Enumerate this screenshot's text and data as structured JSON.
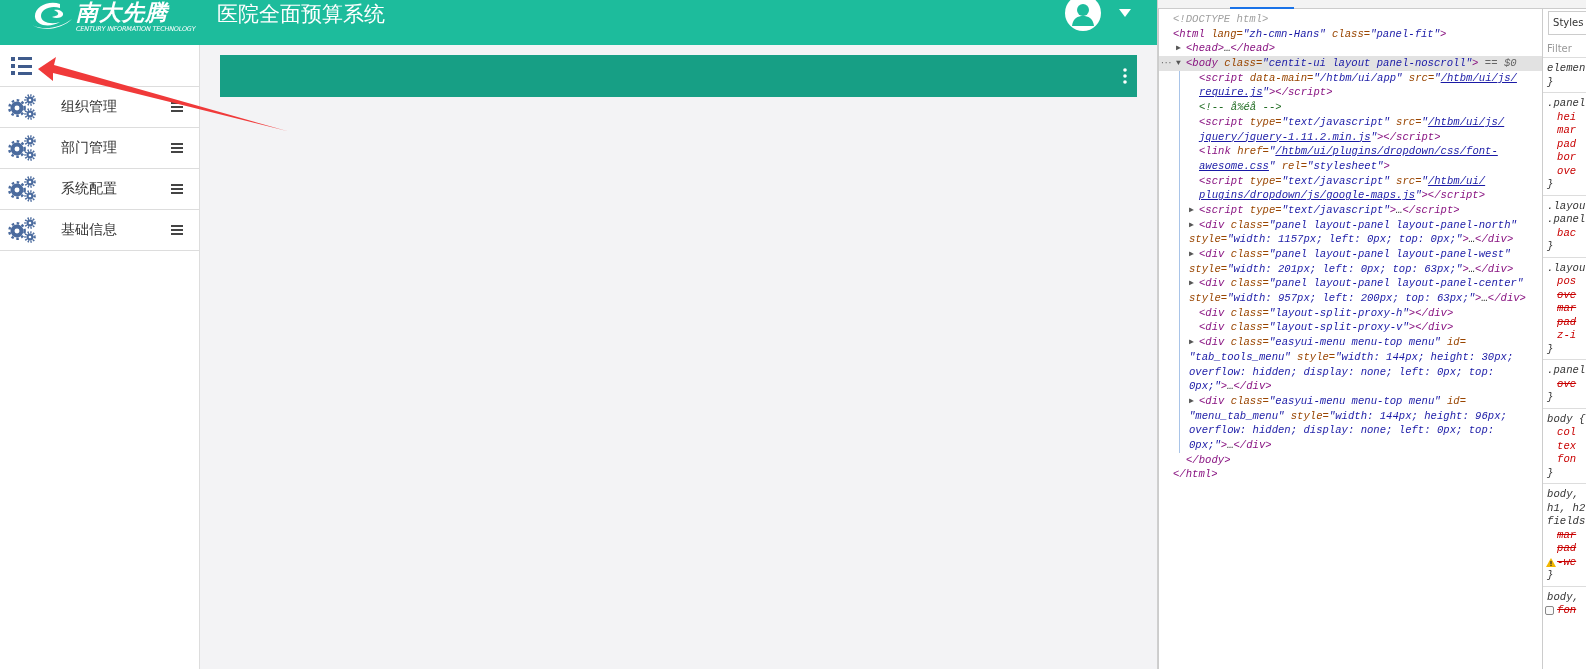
{
  "header": {
    "logo_text": "南大先腾",
    "logo_subtitle": "CENTURY INFORMATION TECHNOLOGY",
    "title": "医院全面预算系统"
  },
  "sidebar": {
    "items": [
      {
        "label": "组织管理"
      },
      {
        "label": "部门管理"
      },
      {
        "label": "系统配置"
      },
      {
        "label": "基础信息"
      }
    ]
  },
  "devtools": {
    "dom": [
      {
        "selected": false,
        "lines": [
          [
            {
              "kind": "doctype",
              "text": "<!DOCTYPE html>"
            }
          ]
        ]
      },
      {
        "selected": false,
        "lines": [
          [
            {
              "kind": "tag",
              "text": "<html"
            },
            {
              "kind": "attr",
              "text": " lang="
            },
            {
              "kind": "value",
              "text": "\"zh-cmn-Hans\""
            },
            {
              "kind": "attr",
              "text": " class="
            },
            {
              "kind": "value",
              "text": "\"panel-fit\""
            },
            {
              "kind": "tag",
              "text": ">"
            }
          ]
        ],
        "close": [
          {
            "kind": "tag",
            "text": "</html>"
          }
        ],
        "children": [
          {
            "selected": false,
            "toggle": "▶",
            "lines": [
              [
                {
                  "kind": "tag",
                  "text": "<head>"
                },
                {
                  "kind": "text",
                  "text": "…"
                },
                {
                  "kind": "tag",
                  "text": "</head>"
                }
              ]
            ]
          },
          {
            "selected": true,
            "prefix": "···",
            "toggle": "▼",
            "lines": [
              [
                {
                  "kind": "tag",
                  "text": "<body"
                },
                {
                  "kind": "attr",
                  "text": " class="
                },
                {
                  "kind": "value",
                  "text": "\"centit-ui layout panel-noscroll\""
                },
                {
                  "kind": "tag",
                  "text": ">"
                },
                {
                  "kind": "marker",
                  "text": " == $0"
                }
              ]
            ],
            "close": [
              {
                "kind": "tag",
                "text": "</body>"
              }
            ],
            "children": [
              {
                "selected": false,
                "lines": [
                  [
                    {
                      "kind": "tag",
                      "text": "<script"
                    },
                    {
                      "kind": "attr",
                      "text": " data-main="
                    },
                    {
                      "kind": "value",
                      "text": "\"/htbm/ui/app\""
                    },
                    {
                      "kind": "attr",
                      "text": " src="
                    },
                    {
                      "kind": "value",
                      "text": "\""
                    },
                    {
                      "kind": "link",
                      "text": "/htbm/ui/js/"
                    }
                  ],
                  [
                    {
                      "kind": "link",
                      "text": "require.js"
                    },
                    {
                      "kind": "value",
                      "text": "\""
                    },
                    {
                      "kind": "tag",
                      "text": "></script>"
                    }
                  ]
                ]
              },
              {
                "selected": false,
                "lines": [
                  [
                    {
                      "kind": "comment",
                      "text": "<!-- å%éå -->"
                    }
                  ]
                ]
              },
              {
                "selected": false,
                "lines": [
                  [
                    {
                      "kind": "tag",
                      "text": "<script"
                    },
                    {
                      "kind": "attr",
                      "text": " type="
                    },
                    {
                      "kind": "value",
                      "text": "\"text/javascript\""
                    },
                    {
                      "kind": "attr",
                      "text": " src="
                    },
                    {
                      "kind": "value",
                      "text": "\""
                    },
                    {
                      "kind": "link",
                      "text": "/htbm/ui/js/"
                    }
                  ],
                  [
                    {
                      "kind": "link",
                      "text": "jquery/jquery-1.11.2.min.js"
                    },
                    {
                      "kind": "value",
                      "text": "\""
                    },
                    {
                      "kind": "tag",
                      "text": "></script>"
                    }
                  ]
                ]
              },
              {
                "selected": false,
                "lines": [
                  [
                    {
                      "kind": "tag",
                      "text": "<link"
                    },
                    {
                      "kind": "attr",
                      "text": " href="
                    },
                    {
                      "kind": "value",
                      "text": "\""
                    },
                    {
                      "kind": "link",
                      "text": "/htbm/ui/plugins/dropdown/css/font-"
                    }
                  ],
                  [
                    {
                      "kind": "link",
                      "text": "awesome.css"
                    },
                    {
                      "kind": "value",
                      "text": "\""
                    },
                    {
                      "kind": "attr",
                      "text": " rel="
                    },
                    {
                      "kind": "value",
                      "text": "\"stylesheet\""
                    },
                    {
                      "kind": "tag",
                      "text": ">"
                    }
                  ]
                ]
              },
              {
                "selected": false,
                "lines": [
                  [
                    {
                      "kind": "tag",
                      "text": "<script"
                    },
                    {
                      "kind": "attr",
                      "text": " type="
                    },
                    {
                      "kind": "value",
                      "text": "\"text/javascript\""
                    },
                    {
                      "kind": "attr",
                      "text": " src="
                    },
                    {
                      "kind": "value",
                      "text": "\""
                    },
                    {
                      "kind": "link",
                      "text": "/htbm/ui/"
                    }
                  ],
                  [
                    {
                      "kind": "link",
                      "text": "plugins/dropdown/js/google-maps.js"
                    },
                    {
                      "kind": "value",
                      "text": "\""
                    },
                    {
                      "kind": "tag",
                      "text": "></script>"
                    }
                  ]
                ]
              },
              {
                "selected": false,
                "toggle": "▶",
                "lines": [
                  [
                    {
                      "kind": "tag",
                      "text": "<script"
                    },
                    {
                      "kind": "attr",
                      "text": " type="
                    },
                    {
                      "kind": "value",
                      "text": "\"text/javascript\""
                    },
                    {
                      "kind": "tag",
                      "text": ">"
                    },
                    {
                      "kind": "text",
                      "text": "…"
                    },
                    {
                      "kind": "tag",
                      "text": "</script>"
                    }
                  ]
                ]
              },
              {
                "selected": false,
                "toggle": "▶",
                "lines": [
                  [
                    {
                      "kind": "tag",
                      "text": "<div"
                    },
                    {
                      "kind": "attr",
                      "text": " class="
                    },
                    {
                      "kind": "value",
                      "text": "\"panel layout-panel layout-panel-north\""
                    }
                  ],
                  [
                    {
                      "kind": "attr",
                      "text": "style="
                    },
                    {
                      "kind": "value",
                      "text": "\"width: 1157px; left: 0px; top: 0px;\""
                    },
                    {
                      "kind": "tag",
                      "text": ">"
                    },
                    {
                      "kind": "text",
                      "text": "…"
                    },
                    {
                      "kind": "tag",
                      "text": "</div>"
                    }
                  ]
                ]
              },
              {
                "selected": false,
                "toggle": "▶",
                "lines": [
                  [
                    {
                      "kind": "tag",
                      "text": "<div"
                    },
                    {
                      "kind": "attr",
                      "text": " class="
                    },
                    {
                      "kind": "value",
                      "text": "\"panel layout-panel layout-panel-west\""
                    }
                  ],
                  [
                    {
                      "kind": "attr",
                      "text": "style="
                    },
                    {
                      "kind": "value",
                      "text": "\"width: 201px; left: 0px; top: 63px;\""
                    },
                    {
                      "kind": "tag",
                      "text": ">"
                    },
                    {
                      "kind": "text",
                      "text": "…"
                    },
                    {
                      "kind": "tag",
                      "text": "</div>"
                    }
                  ]
                ]
              },
              {
                "selected": false,
                "toggle": "▶",
                "lines": [
                  [
                    {
                      "kind": "tag",
                      "text": "<div"
                    },
                    {
                      "kind": "attr",
                      "text": " class="
                    },
                    {
                      "kind": "value",
                      "text": "\"panel layout-panel layout-panel-center\""
                    }
                  ],
                  [
                    {
                      "kind": "attr",
                      "text": "style="
                    },
                    {
                      "kind": "value",
                      "text": "\"width: 957px; left: 200px; top: 63px;\""
                    },
                    {
                      "kind": "tag",
                      "text": ">"
                    },
                    {
                      "kind": "text",
                      "text": "…"
                    },
                    {
                      "kind": "tag",
                      "text": "</div>"
                    }
                  ]
                ]
              },
              {
                "selected": false,
                "lines": [
                  [
                    {
                      "kind": "tag",
                      "text": "<div"
                    },
                    {
                      "kind": "attr",
                      "text": " class="
                    },
                    {
                      "kind": "value",
                      "text": "\"layout-split-proxy-h\""
                    },
                    {
                      "kind": "tag",
                      "text": "></div>"
                    }
                  ]
                ]
              },
              {
                "selected": false,
                "lines": [
                  [
                    {
                      "kind": "tag",
                      "text": "<div"
                    },
                    {
                      "kind": "attr",
                      "text": " class="
                    },
                    {
                      "kind": "value",
                      "text": "\"layout-split-proxy-v\""
                    },
                    {
                      "kind": "tag",
                      "text": "></div>"
                    }
                  ]
                ]
              },
              {
                "selected": false,
                "toggle": "▶",
                "lines": [
                  [
                    {
                      "kind": "tag",
                      "text": "<div"
                    },
                    {
                      "kind": "attr",
                      "text": " class="
                    },
                    {
                      "kind": "value",
                      "text": "\"easyui-menu menu-top menu\""
                    },
                    {
                      "kind": "attr",
                      "text": " id="
                    }
                  ],
                  [
                    {
                      "kind": "value",
                      "text": "\"tab_tools_menu\""
                    },
                    {
                      "kind": "attr",
                      "text": " style="
                    },
                    {
                      "kind": "value",
                      "text": "\"width: 144px; height: 30px;"
                    }
                  ],
                  [
                    {
                      "kind": "value",
                      "text": "overflow: hidden; display: none; left: 0px; top:"
                    }
                  ],
                  [
                    {
                      "kind": "value",
                      "text": "0px;\""
                    },
                    {
                      "kind": "tag",
                      "text": ">"
                    },
                    {
                      "kind": "text",
                      "text": "…"
                    },
                    {
                      "kind": "tag",
                      "text": "</div>"
                    }
                  ]
                ]
              },
              {
                "selected": false,
                "toggle": "▶",
                "lines": [
                  [
                    {
                      "kind": "tag",
                      "text": "<div"
                    },
                    {
                      "kind": "attr",
                      "text": " class="
                    },
                    {
                      "kind": "value",
                      "text": "\"easyui-menu menu-top menu\""
                    },
                    {
                      "kind": "attr",
                      "text": " id="
                    }
                  ],
                  [
                    {
                      "kind": "value",
                      "text": "\"menu_tab_menu\""
                    },
                    {
                      "kind": "attr",
                      "text": " style="
                    },
                    {
                      "kind": "value",
                      "text": "\"width: 144px; height: 96px;"
                    }
                  ],
                  [
                    {
                      "kind": "value",
                      "text": "overflow: hidden; display: none; left: 0px; top:"
                    }
                  ],
                  [
                    {
                      "kind": "value",
                      "text": "0px;\""
                    },
                    {
                      "kind": "tag",
                      "text": ">"
                    },
                    {
                      "kind": "text",
                      "text": "…"
                    },
                    {
                      "kind": "tag",
                      "text": "</div>"
                    }
                  ]
                ]
              }
            ]
          }
        ]
      }
    ],
    "styles": {
      "tab": "Styles",
      "filter_placeholder": "Filter",
      "rules": [
        {
          "selectors": [
            "elemen"
          ],
          "close": "}"
        },
        {
          "selectors": [
            ".panel"
          ],
          "props": [
            {
              "kind": "plain",
              "name": "hei",
              "disabled": false
            },
            {
              "kind": "plain",
              "name": "mar",
              "disabled": false
            },
            {
              "kind": "plain",
              "name": "pad",
              "disabled": false
            },
            {
              "kind": "plain",
              "name": "bor",
              "disabled": false
            },
            {
              "kind": "plain",
              "name": "ove",
              "disabled": false
            }
          ],
          "close": "}"
        },
        {
          "selectors": [
            ".layou",
            ".panel"
          ],
          "props": [
            {
              "kind": "plain",
              "name": "bac",
              "disabled": false
            }
          ],
          "close": "}"
        },
        {
          "selectors": [
            ".layou"
          ],
          "props": [
            {
              "kind": "plain",
              "name": "pos",
              "disabled": false
            },
            {
              "kind": "plain",
              "name": "ove",
              "disabled": true
            },
            {
              "kind": "plain",
              "name": "mar",
              "disabled": true
            },
            {
              "kind": "plain",
              "name": "pad",
              "disabled": true
            },
            {
              "kind": "plain",
              "name": "z-i",
              "disabled": false
            }
          ],
          "close": "}"
        },
        {
          "selectors": [
            ".panel"
          ],
          "props": [
            {
              "kind": "plain",
              "name": "ove",
              "disabled": true
            }
          ],
          "close": "}"
        },
        {
          "selectors": [
            "body {"
          ],
          "props": [
            {
              "kind": "plain",
              "name": "col",
              "disabled": false
            },
            {
              "kind": "plain",
              "name": "tex",
              "disabled": false
            },
            {
              "kind": "plain",
              "name": "fon",
              "disabled": false
            }
          ],
          "close": "}"
        },
        {
          "selectors": [
            "body,",
            "h1, h2",
            "fields"
          ],
          "props": [
            {
              "kind": "plain",
              "name": "mar",
              "disabled": true
            },
            {
              "kind": "plain",
              "name": "pad",
              "disabled": true
            },
            {
              "kind": "warning",
              "name": "-we",
              "disabled": true
            }
          ],
          "close": "}"
        },
        {
          "selectors": [
            "body,"
          ],
          "props": [
            {
              "kind": "checkbox",
              "name": "fon",
              "disabled": true,
              "checked": false
            }
          ]
        }
      ]
    }
  }
}
